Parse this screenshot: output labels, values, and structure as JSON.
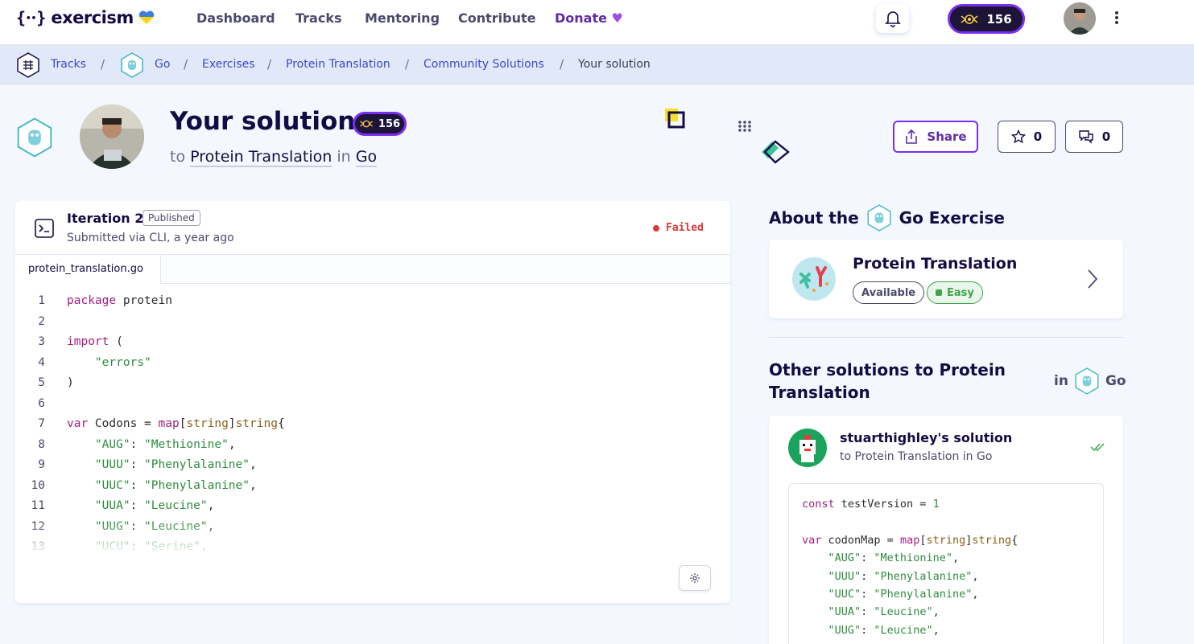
{
  "nav": {
    "logo_text": "exercism",
    "links": [
      "Dashboard",
      "Tracks",
      "Mentoring",
      "Contribute",
      "Donate"
    ],
    "reputation": "156"
  },
  "breadcrumb": {
    "items": [
      "Tracks",
      "Go",
      "Exercises",
      "Protein Translation",
      "Community Solutions"
    ],
    "current": "Your solution"
  },
  "header": {
    "title": "Your solution",
    "reputation": "156",
    "sub_to": "to",
    "exercise": "Protein Translation",
    "sub_in": "in",
    "track": "Go",
    "share_label": "Share",
    "stars": "0",
    "comments": "0"
  },
  "iteration": {
    "title": "Iteration 2",
    "badge": "Published",
    "submitted": "Submitted via CLI, a year ago",
    "status": "Failed",
    "file_tab": "protein_translation.go",
    "lines": [
      {
        "n": "1",
        "t": "package protein"
      },
      {
        "n": "2",
        "t": ""
      },
      {
        "n": "3",
        "t": "import ("
      },
      {
        "n": "4",
        "t": "    \"errors\""
      },
      {
        "n": "5",
        "t": ")"
      },
      {
        "n": "6",
        "t": ""
      },
      {
        "n": "7",
        "t": "var Codons = map[string]string{"
      },
      {
        "n": "8",
        "t": "    \"AUG\": \"Methionine\","
      },
      {
        "n": "9",
        "t": "    \"UUU\": \"Phenylalanine\","
      },
      {
        "n": "10",
        "t": "    \"UUC\": \"Phenylalanine\","
      },
      {
        "n": "11",
        "t": "    \"UUA\": \"Leucine\","
      },
      {
        "n": "12",
        "t": "    \"UUG\": \"Leucine\","
      },
      {
        "n": "13",
        "t": "    \"UCU\": \"Serine\","
      }
    ]
  },
  "about": {
    "title_prefix": "About the",
    "title_suffix": "Go Exercise",
    "exercise_name": "Protein Translation",
    "tag_available": "Available",
    "tag_difficulty": "Easy"
  },
  "other": {
    "title": "Other solutions to Protein Translation",
    "in_label": "in",
    "track": "Go",
    "solution": {
      "author": "stuarthighley's solution",
      "to": "to Protein Translation in Go",
      "code": [
        "const testVersion = 1",
        "",
        "var codonMap = map[string]string{",
        "    \"AUG\": \"Methionine\",",
        "    \"UUU\": \"Phenylalanine\",",
        "    \"UUC\": \"Phenylalanine\",",
        "    \"UUA\": \"Leucine\",",
        "    \"UUG\": \"Leucine\","
      ]
    }
  },
  "colors": {
    "accent": "#7a2ff0",
    "link": "#3b49c4",
    "failed": "#d83b3b",
    "easy": "#3fa44a"
  }
}
